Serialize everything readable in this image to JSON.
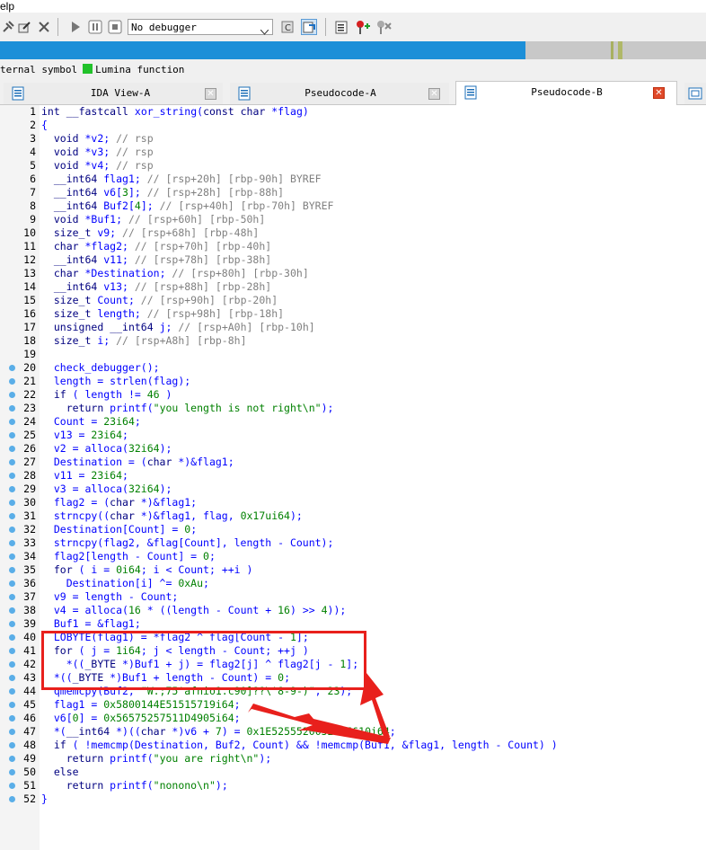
{
  "menubar": {
    "text": "elp"
  },
  "toolbar": {
    "debugger_select": "No debugger",
    "icons": [
      "pin-icon",
      "edit-icon",
      "close-x-icon",
      "play-icon",
      "pause-icon",
      "stop-icon",
      "attach-icon",
      "step-icon",
      "graph-icon",
      "add-breakpoint-icon",
      "remove-breakpoint-icon"
    ]
  },
  "legend": {
    "items": [
      {
        "text": "ternal symbol"
      },
      {
        "text": "Lumina function"
      }
    ],
    "lumina_color": "#22c22a"
  },
  "tabs": [
    {
      "label": "IDA View-A",
      "active": false
    },
    {
      "label": "Pseudocode-A",
      "active": false
    },
    {
      "label": "Pseudocode-B",
      "active": true
    }
  ],
  "colors": {
    "accent_blue": "#1d8fd8",
    "highlight_red": "#e8201c",
    "breakpoint_dot": "#5aaee8"
  },
  "code": {
    "lines": [
      {
        "n": "1",
        "dot": false,
        "t": "int __fastcall xor_string(const char *flag)"
      },
      {
        "n": "2",
        "dot": false,
        "t": "{"
      },
      {
        "n": "3",
        "dot": false,
        "t": "  void *v2; // rsp"
      },
      {
        "n": "4",
        "dot": false,
        "t": "  void *v3; // rsp"
      },
      {
        "n": "5",
        "dot": false,
        "t": "  void *v4; // rsp"
      },
      {
        "n": "6",
        "dot": false,
        "t": "  __int64 flag1; // [rsp+20h] [rbp-90h] BYREF"
      },
      {
        "n": "7",
        "dot": false,
        "t": "  __int64 v6[3]; // [rsp+28h] [rbp-88h]"
      },
      {
        "n": "8",
        "dot": false,
        "t": "  __int64 Buf2[4]; // [rsp+40h] [rbp-70h] BYREF"
      },
      {
        "n": "9",
        "dot": false,
        "t": "  void *Buf1; // [rsp+60h] [rbp-50h]"
      },
      {
        "n": "10",
        "dot": false,
        "t": "  size_t v9; // [rsp+68h] [rbp-48h]"
      },
      {
        "n": "11",
        "dot": false,
        "t": "  char *flag2; // [rsp+70h] [rbp-40h]"
      },
      {
        "n": "12",
        "dot": false,
        "t": "  __int64 v11; // [rsp+78h] [rbp-38h]"
      },
      {
        "n": "13",
        "dot": false,
        "t": "  char *Destination; // [rsp+80h] [rbp-30h]"
      },
      {
        "n": "14",
        "dot": false,
        "t": "  __int64 v13; // [rsp+88h] [rbp-28h]"
      },
      {
        "n": "15",
        "dot": false,
        "t": "  size_t Count; // [rsp+90h] [rbp-20h]"
      },
      {
        "n": "16",
        "dot": false,
        "t": "  size_t length; // [rsp+98h] [rbp-18h]"
      },
      {
        "n": "17",
        "dot": false,
        "t": "  unsigned __int64 j; // [rsp+A0h] [rbp-10h]"
      },
      {
        "n": "18",
        "dot": false,
        "t": "  size_t i; // [rsp+A8h] [rbp-8h]"
      },
      {
        "n": "19",
        "dot": false,
        "t": ""
      },
      {
        "n": "20",
        "dot": true,
        "t": "  check_debugger();"
      },
      {
        "n": "21",
        "dot": true,
        "t": "  length = strlen(flag);"
      },
      {
        "n": "22",
        "dot": true,
        "t": "  if ( length != 46 )"
      },
      {
        "n": "23",
        "dot": true,
        "t": "    return printf(\"you length is not right\\n\");"
      },
      {
        "n": "24",
        "dot": true,
        "t": "  Count = 23i64;"
      },
      {
        "n": "25",
        "dot": true,
        "t": "  v13 = 23i64;"
      },
      {
        "n": "26",
        "dot": true,
        "t": "  v2 = alloca(32i64);"
      },
      {
        "n": "27",
        "dot": true,
        "t": "  Destination = (char *)&flag1;"
      },
      {
        "n": "28",
        "dot": true,
        "t": "  v11 = 23i64;"
      },
      {
        "n": "29",
        "dot": true,
        "t": "  v3 = alloca(32i64);"
      },
      {
        "n": "30",
        "dot": true,
        "t": "  flag2 = (char *)&flag1;"
      },
      {
        "n": "31",
        "dot": true,
        "t": "  strncpy((char *)&flag1, flag, 0x17ui64);"
      },
      {
        "n": "32",
        "dot": true,
        "t": "  Destination[Count] = 0;"
      },
      {
        "n": "33",
        "dot": true,
        "t": "  strncpy(flag2, &flag[Count], length - Count);"
      },
      {
        "n": "34",
        "dot": true,
        "t": "  flag2[length - Count] = 0;"
      },
      {
        "n": "35",
        "dot": true,
        "t": "  for ( i = 0i64; i < Count; ++i )"
      },
      {
        "n": "36",
        "dot": true,
        "t": "    Destination[i] ^= 0xAu;"
      },
      {
        "n": "37",
        "dot": true,
        "t": "  v9 = length - Count;"
      },
      {
        "n": "38",
        "dot": true,
        "t": "  v4 = alloca(16 * ((length - Count + 16) >> 4));"
      },
      {
        "n": "39",
        "dot": true,
        "t": "  Buf1 = &flag1;"
      },
      {
        "n": "40",
        "dot": true,
        "t": "  LOBYTE(flag1) = *flag2 ^ flag[Count - 1];"
      },
      {
        "n": "41",
        "dot": true,
        "t": "  for ( j = 1i64; j < length - Count; ++j )"
      },
      {
        "n": "42",
        "dot": true,
        "t": "    *((_BYTE *)Buf1 + j) = flag2[j] ^ flag2[j - 1];"
      },
      {
        "n": "43",
        "dot": true,
        "t": "  *((_BYTE *)Buf1 + length - Count) = 0;"
      },
      {
        "n": "44",
        "dot": true,
        "t": "  qmemcpy(Buf2, \"W.;75'afnio1.c90]??\\'8-9-)\", 23);"
      },
      {
        "n": "45",
        "dot": true,
        "t": "  flag1 = 0x5800144E51515719i64;"
      },
      {
        "n": "46",
        "dot": true,
        "t": "  v6[0] = 0x56575257511D4905i64;"
      },
      {
        "n": "47",
        "dot": true,
        "t": "  *(__int64 *)((char *)v6 + 7) = 0x1E5255520052015610i64;"
      },
      {
        "n": "48",
        "dot": true,
        "t": "  if ( !memcmp(Destination, Buf2, Count) && !memcmp(Buf1, &flag1, length - Count) )"
      },
      {
        "n": "49",
        "dot": true,
        "t": "    return printf(\"you are right\\n\");"
      },
      {
        "n": "50",
        "dot": true,
        "t": "  else"
      },
      {
        "n": "51",
        "dot": true,
        "t": "    return printf(\"nonono\\n\");"
      },
      {
        "n": "52",
        "dot": true,
        "t": "}"
      }
    ]
  }
}
